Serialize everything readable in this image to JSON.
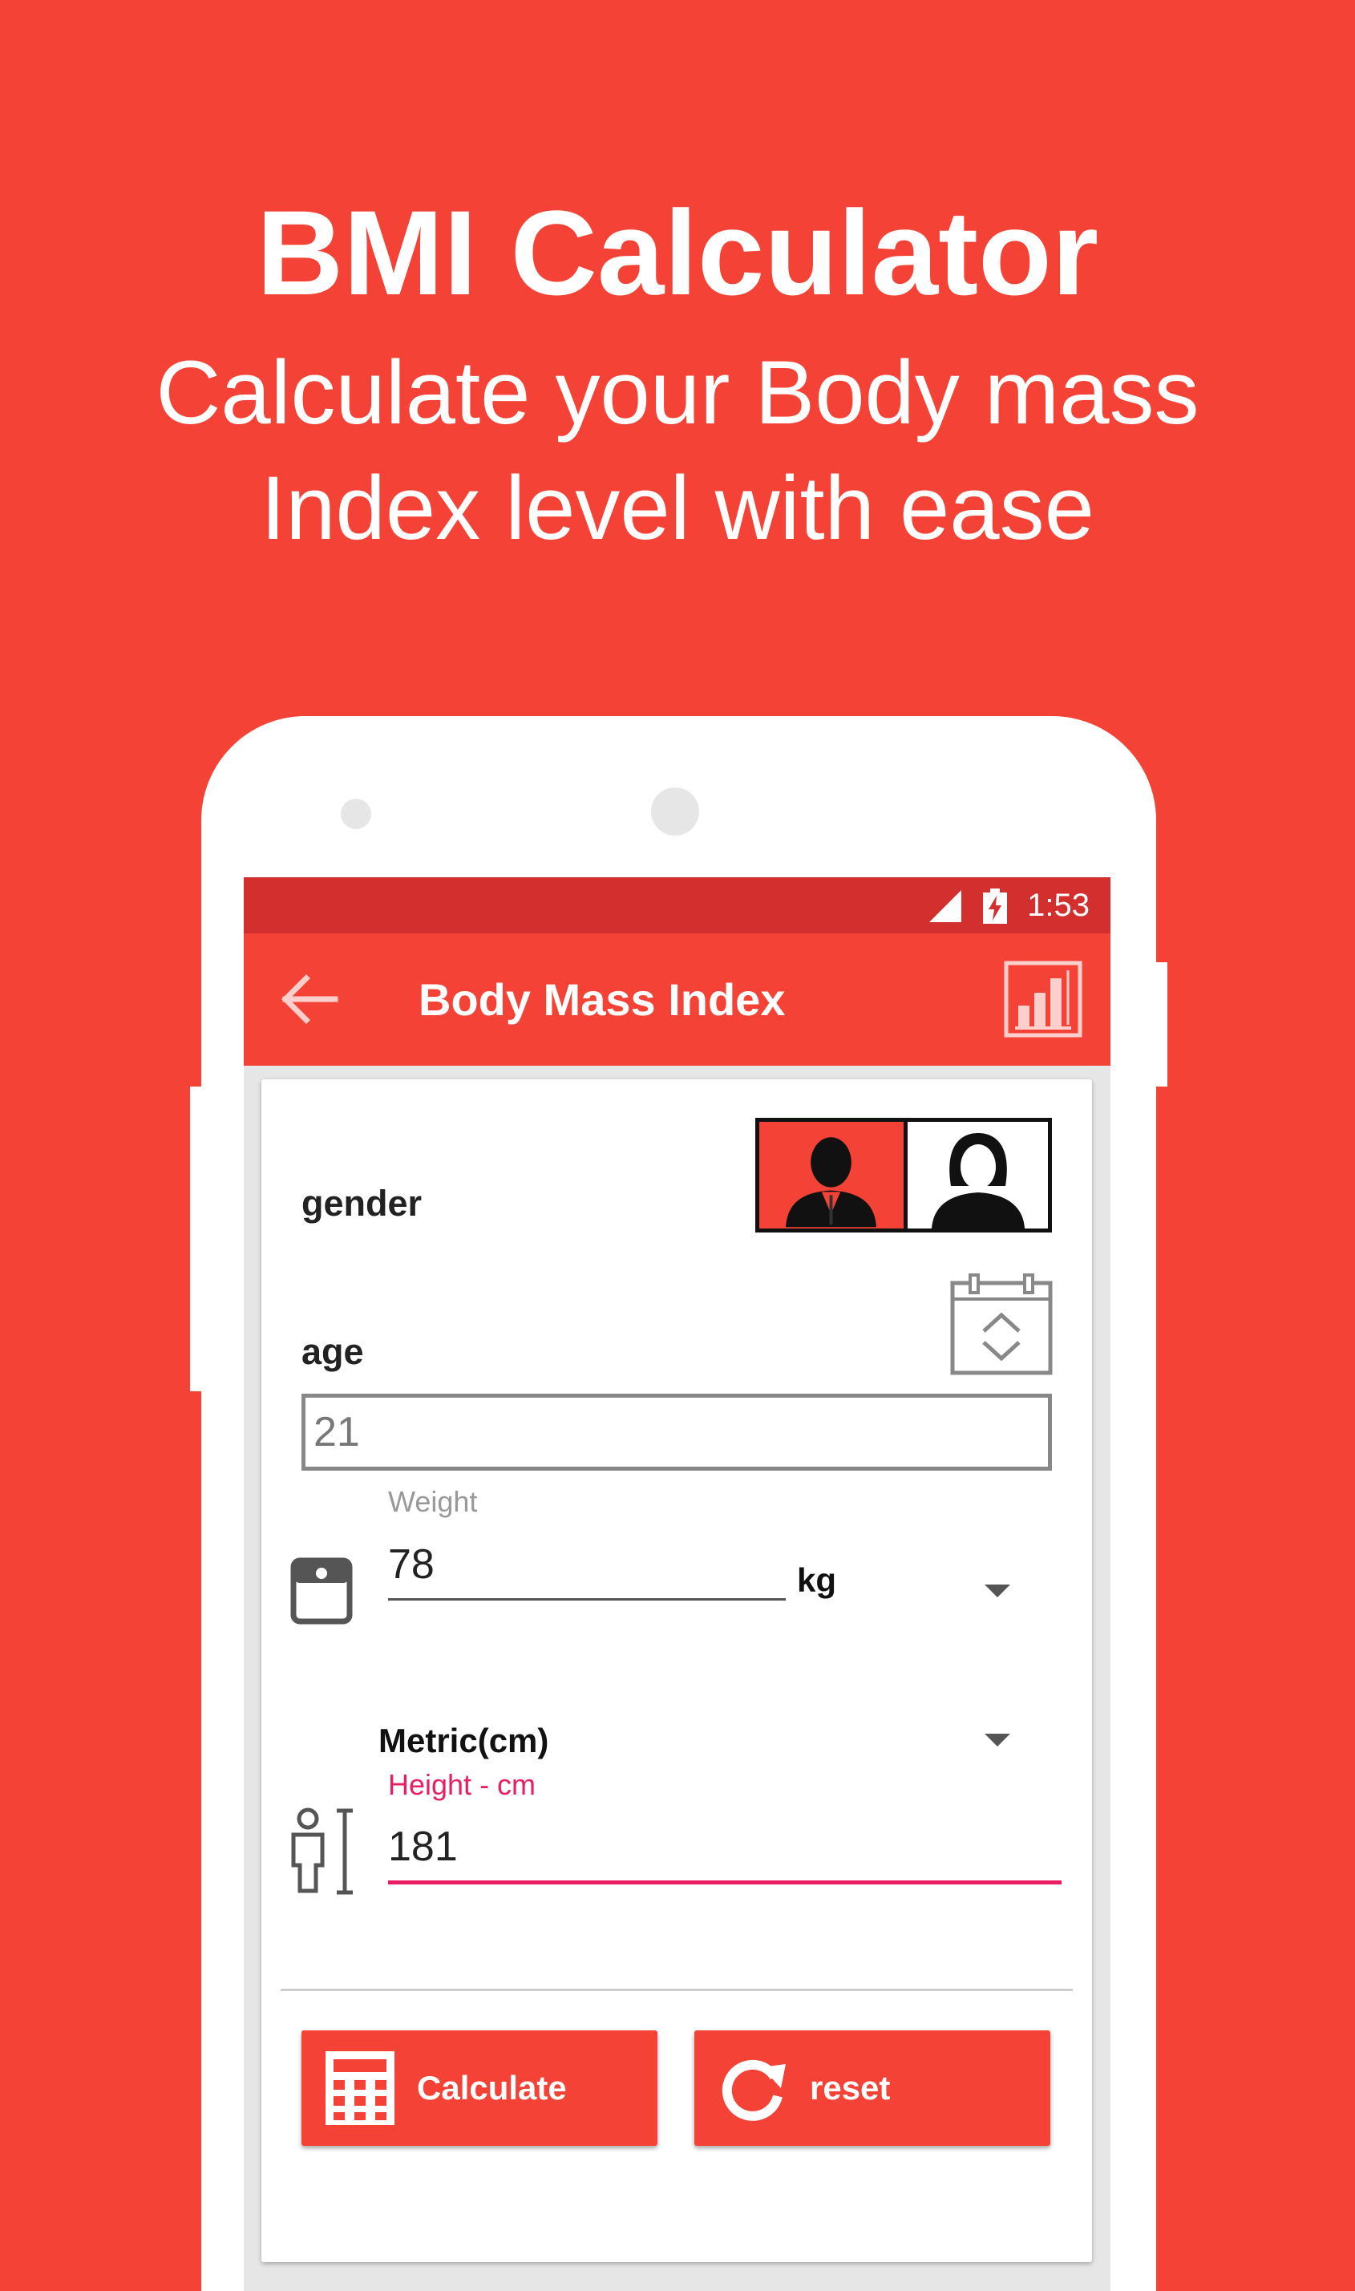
{
  "promo": {
    "title": "BMI Calculator",
    "subtitle_line1": "Calculate your Body mass",
    "subtitle_line2": "Index level with ease"
  },
  "status_bar": {
    "time": "1:53"
  },
  "app_bar": {
    "title": "Body Mass Index"
  },
  "form": {
    "gender_label": "gender",
    "age_label": "age",
    "age_value": "21",
    "weight_label": "Weight",
    "weight_value": "78",
    "weight_unit": "kg",
    "height_unit_system": "Metric(cm)",
    "height_label": "Height - cm",
    "height_value": "181"
  },
  "buttons": {
    "calculate_label": "Calculate",
    "reset_label": "reset"
  },
  "colors": {
    "primary": "#f44336",
    "status_bar": "#d32f2f",
    "accent": "#e91e63",
    "selected_gender": "male"
  },
  "icons": {
    "back": "arrow-left-icon",
    "stats": "bar-chart-icon",
    "male": "male-avatar-icon",
    "female": "female-avatar-icon",
    "calendar": "calendar-icon",
    "weight": "scale-icon",
    "height": "person-height-icon",
    "calculate": "calculator-icon",
    "reset": "refresh-icon"
  }
}
